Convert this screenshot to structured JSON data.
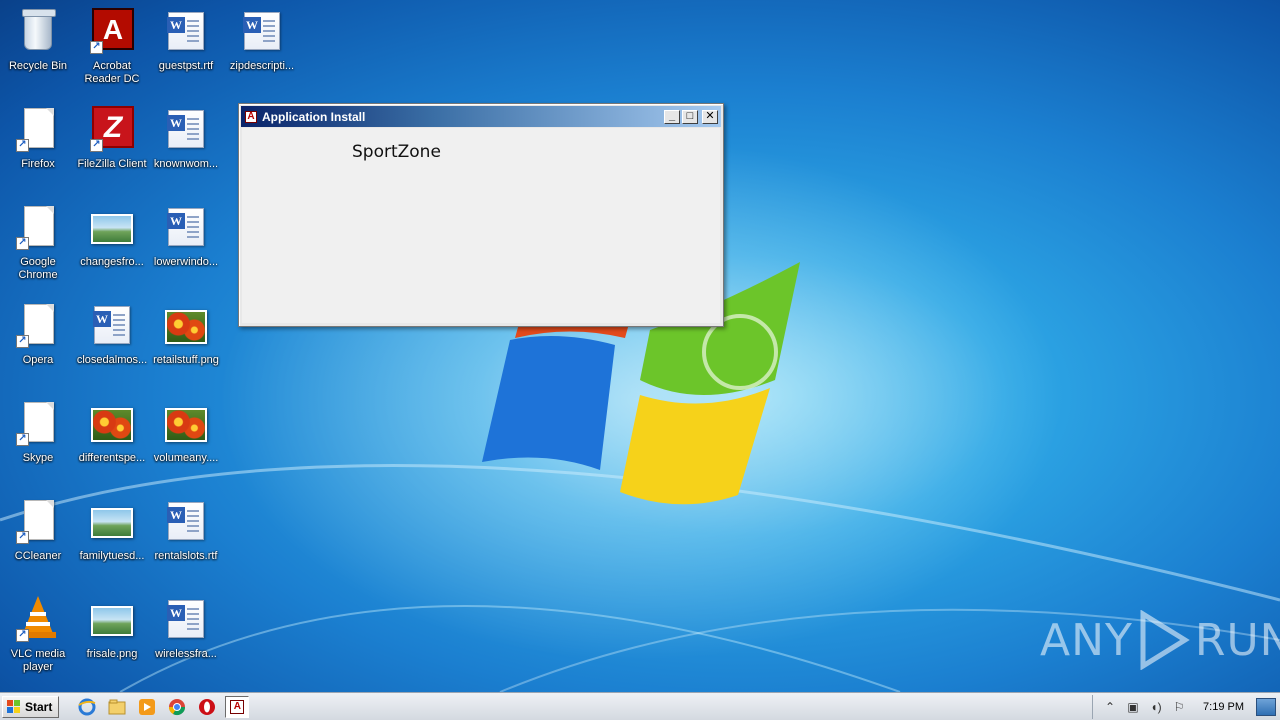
{
  "desktop": {
    "icons": [
      {
        "label": "Recycle Bin"
      },
      {
        "label": "Acrobat Reader DC"
      },
      {
        "label": "guestpst.rtf"
      },
      {
        "label": "zipdescripti..."
      },
      {
        "label": "Firefox"
      },
      {
        "label": "FileZilla Client"
      },
      {
        "label": "knownwom..."
      },
      {
        "label": "Google Chrome"
      },
      {
        "label": "changesfro..."
      },
      {
        "label": "lowerwindo..."
      },
      {
        "label": "Opera"
      },
      {
        "label": "closedalmos..."
      },
      {
        "label": "retailstuff.png"
      },
      {
        "label": "Skype"
      },
      {
        "label": "differentspe..."
      },
      {
        "label": "volumeany...."
      },
      {
        "label": "CCleaner"
      },
      {
        "label": "familytuesd..."
      },
      {
        "label": "rentalslots.rtf"
      },
      {
        "label": "VLC media player"
      },
      {
        "label": "frisale.png"
      },
      {
        "label": "wirelessfra..."
      }
    ]
  },
  "dialog": {
    "title": "Application Install",
    "app_name": "SportZone",
    "minimize_glyph": "_",
    "maximize_glyph": "□",
    "close_glyph": "✕"
  },
  "taskbar": {
    "start_label": "Start",
    "clock": "7:19 PM",
    "pinned": [
      "ie-icon",
      "explorer-icon",
      "media-player-icon",
      "chrome-icon",
      "opera-icon",
      "app-install-icon"
    ]
  },
  "watermark": {
    "left": "ANY",
    "right": "RUN"
  }
}
